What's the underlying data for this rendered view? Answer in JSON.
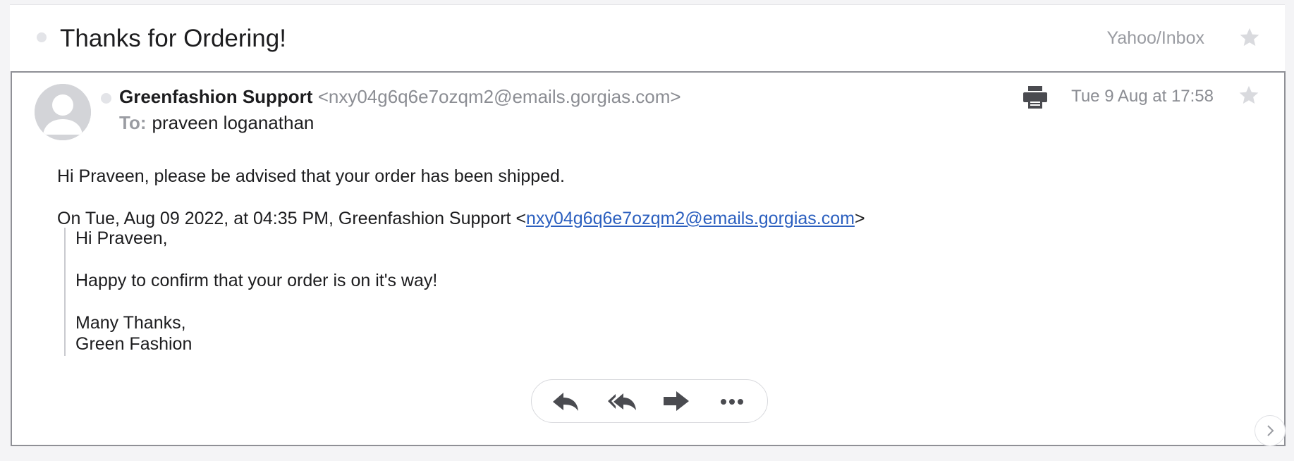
{
  "thread": {
    "subject": "Thanks for Ordering!",
    "folder": "Yahoo/Inbox"
  },
  "message": {
    "sender_name": "Greenfashion Support",
    "sender_email": "<nxy04g6q6e7ozqm2@emails.gorgias.com>",
    "to_label": "To:",
    "to_name": "praveen loganathan",
    "date": "Tue 9 Aug at 17:58",
    "body_line": "Hi Praveen, please be advised that your order has been shipped.",
    "quote_intro_prefix": "On Tue, Aug 09 2022, at 04:35 PM, Greenfashion Support <",
    "quote_intro_link": "nxy04g6q6e7ozqm2@emails.gorgias.com",
    "quote_intro_suffix": ">",
    "quote_lines": {
      "greeting": "Hi Praveen,",
      "confirm": "Happy to confirm that your order is on it's way!",
      "thanks": "Many Thanks,",
      "signature": "Green Fashion"
    }
  },
  "icons": {
    "star": "star-icon",
    "print": "printer-icon",
    "reply": "reply-icon",
    "reply_all": "reply-all-icon",
    "forward": "forward-icon",
    "more": "more-icon",
    "next": "chevron-right-icon"
  },
  "colors": {
    "link": "#2b5fbf",
    "icon_dark": "#4a4b50",
    "icon_light": "#d9dade",
    "muted_text": "#8b8d93"
  }
}
